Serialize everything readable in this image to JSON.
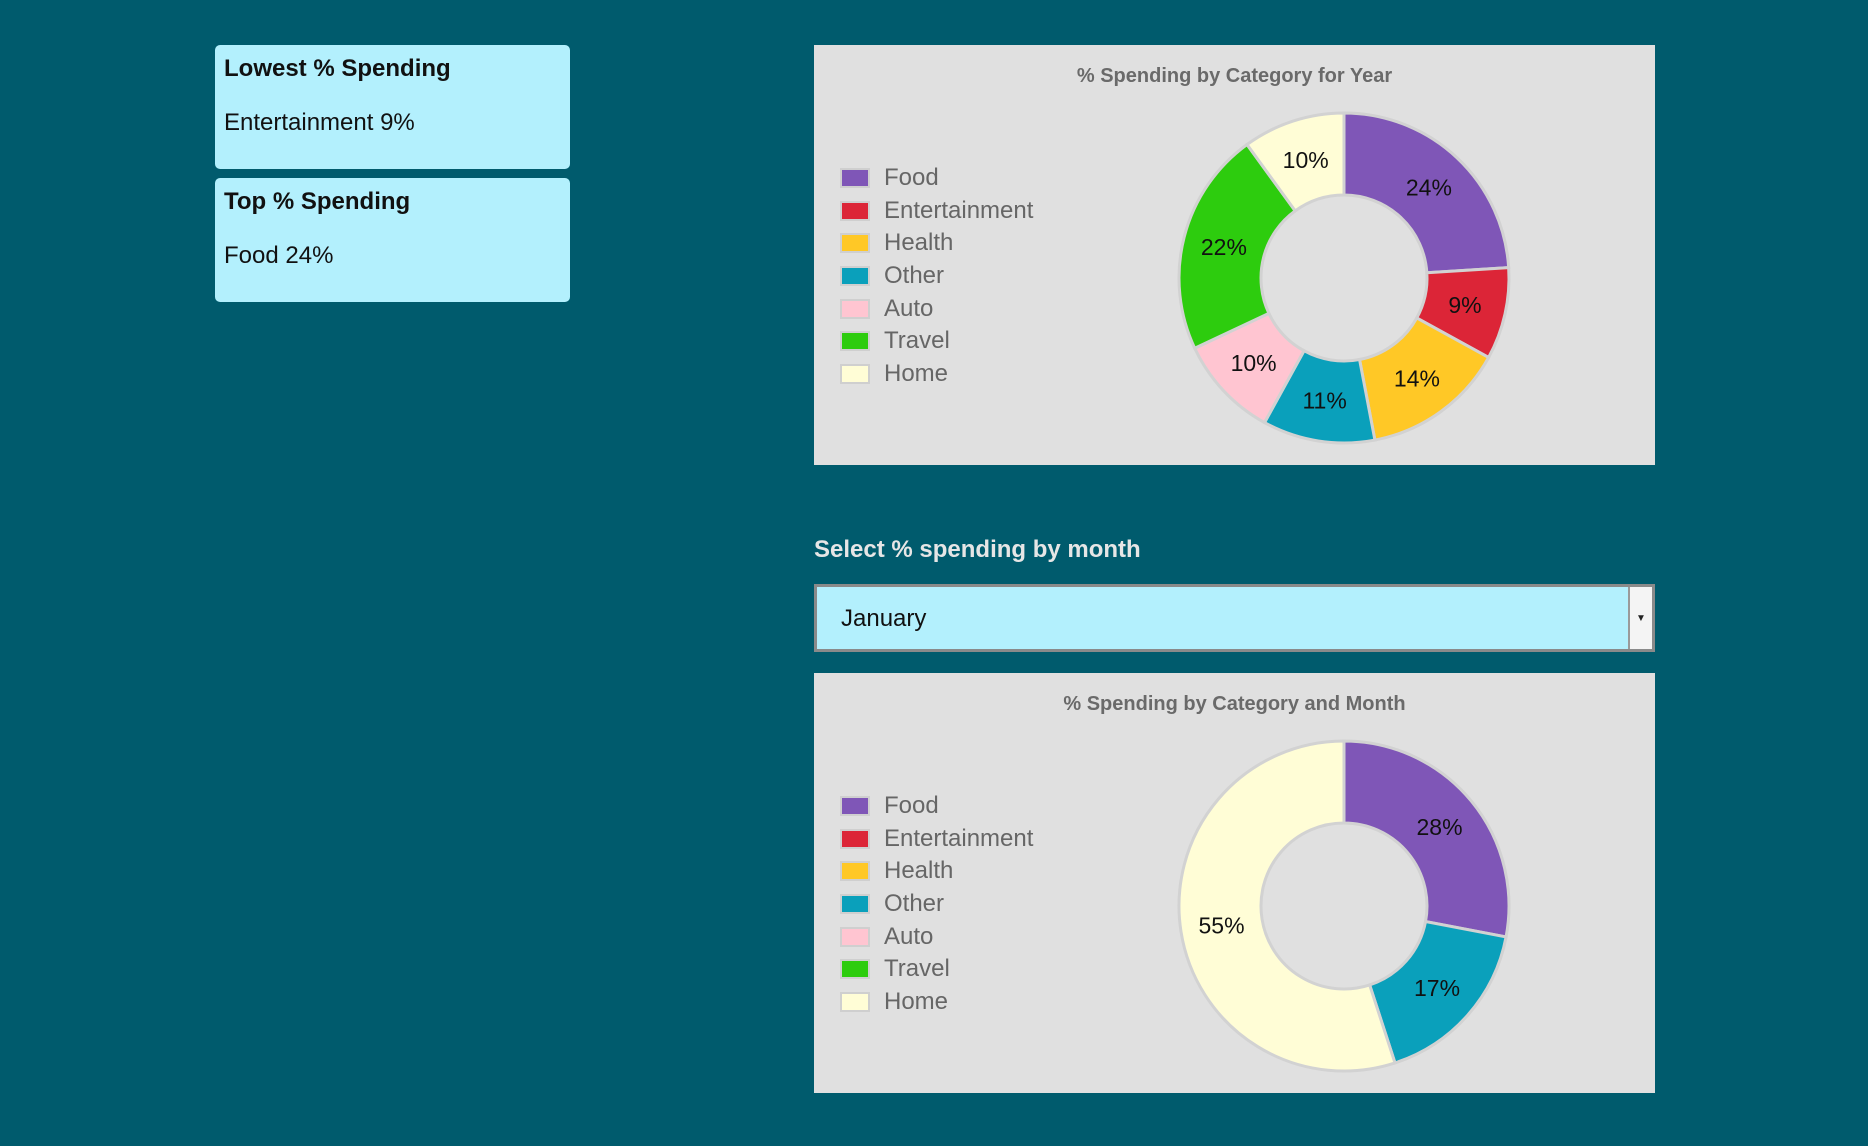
{
  "cards": {
    "lowest": {
      "title": "Lowest % Spending",
      "value": "Entertainment 9%"
    },
    "top": {
      "title": "Top % Spending",
      "value": "Food 24%"
    }
  },
  "month_selector": {
    "label": "Select % spending by month",
    "selected": "January"
  },
  "legend_colors": {
    "Food": "#7f56b7",
    "Entertainment": "#dc2537",
    "Health": "#ffc826",
    "Other": "#0aa0bb",
    "Auto": "#ffc5d1",
    "Travel": "#2dcc0e",
    "Home": "#fffdd6"
  },
  "chart_data": [
    {
      "type": "pie",
      "title": "% Spending by Category for Year",
      "categories": [
        "Food",
        "Entertainment",
        "Health",
        "Other",
        "Auto",
        "Travel",
        "Home"
      ],
      "values": [
        24,
        9,
        14,
        11,
        10,
        22,
        10
      ],
      "labels": [
        "24%",
        "9%",
        "14%",
        "11%",
        "10%",
        "22%",
        "10%"
      ],
      "legend": "left"
    },
    {
      "type": "pie",
      "title": "% Spending by Category and Month",
      "categories": [
        "Food",
        "Entertainment",
        "Health",
        "Other",
        "Auto",
        "Travel",
        "Home"
      ],
      "values": [
        28,
        0,
        0,
        17,
        0,
        0,
        55
      ],
      "labels": [
        "28%",
        "",
        "",
        "17%",
        "",
        "",
        "55%"
      ],
      "legend": "left"
    }
  ]
}
